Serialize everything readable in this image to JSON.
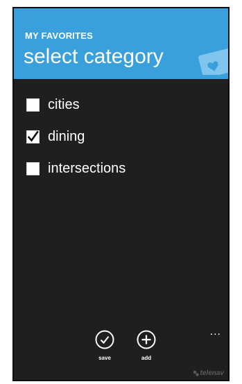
{
  "header": {
    "app_title": "MY FAVORITES",
    "page_title": "select category",
    "accent_color": "#3aa0db",
    "icon": "heart-card-icon"
  },
  "categories": [
    {
      "label": "cities",
      "checked": false
    },
    {
      "label": "dining",
      "checked": true
    },
    {
      "label": "intersections",
      "checked": false
    }
  ],
  "appbar": {
    "save_label": "save",
    "save_icon": "check-circle-icon",
    "add_label": "add",
    "add_icon": "plus-circle-icon",
    "more": "..."
  },
  "brand": {
    "name": "telenav"
  }
}
